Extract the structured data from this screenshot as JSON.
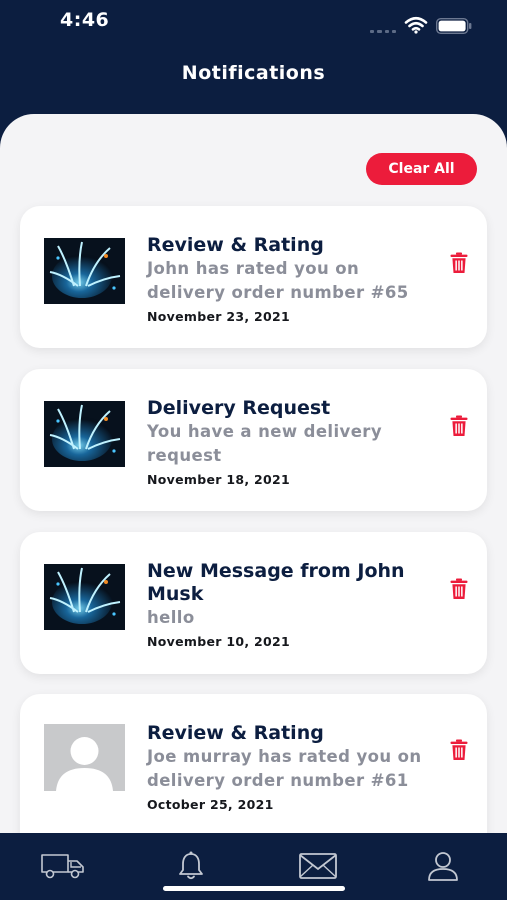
{
  "status_bar": {
    "time": "4:46"
  },
  "header": {
    "title": "Notifications"
  },
  "clear_all_label": "Clear All",
  "notifications": [
    {
      "title": "Review & Rating",
      "message": "John has rated you on delivery order number #65",
      "date": "November 23, 2021",
      "avatar": "flower-image"
    },
    {
      "title": "Delivery Request",
      "message": "You have a new delivery request",
      "date": "November 18, 2021",
      "avatar": "flower-image"
    },
    {
      "title": "New Message from John Musk",
      "message": "hello",
      "date": "November 10, 2021",
      "avatar": "flower-image"
    },
    {
      "title": "Review & Rating",
      "message": "Joe murray has rated you on delivery order number #61",
      "date": "October 25, 2021",
      "avatar": "default-user-avatar"
    }
  ],
  "tab_bar": {
    "icons": [
      "truck-icon",
      "bell-icon",
      "envelope-icon",
      "user-icon"
    ]
  },
  "colors": {
    "navy": "#0c1e40",
    "accent_red": "#ec1c3b",
    "message_gray": "#8b8e99"
  }
}
